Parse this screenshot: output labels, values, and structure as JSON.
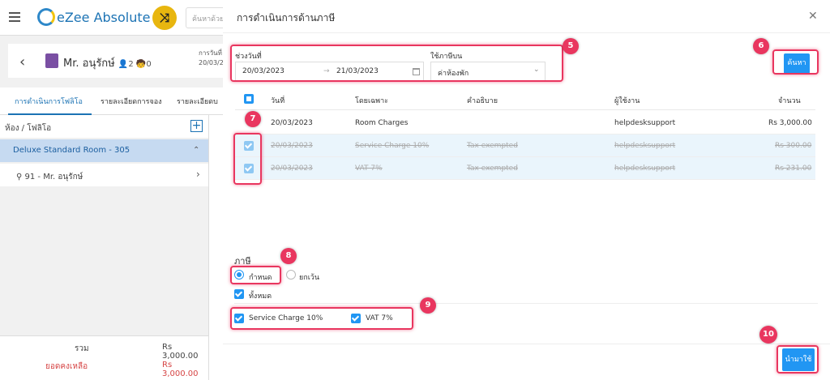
{
  "app": {
    "name": "eZee Absolute",
    "search_placeholder": "ค้นหาด้วย"
  },
  "guest": {
    "name": "Mr. อนุรักษ์",
    "adults": "2",
    "children": "0",
    "date_label": "การวันที่",
    "date_value": "20/03/2"
  },
  "tabs": [
    "การดำเนินการโฟลิโอ",
    "รายละเอียดการจอง",
    "รายละเอียดบ"
  ],
  "sidebar": {
    "header": "ห้อง / โฟลิโอ",
    "room": "Deluxe Standard Room - 305",
    "guest_folio": "91 - Mr. อนุรักษ์",
    "total_label": "รวม",
    "total_value": "Rs 3,000.00",
    "balance_label": "ยอดคงเหลือ",
    "balance_value": "Rs 3,000.00"
  },
  "modal": {
    "title": "การดำเนินการด้านภาษี",
    "date_range_label": "ช่วงวันที่",
    "date_from": "20/03/2023",
    "date_to": "21/03/2023",
    "date_arrow": "→",
    "apply_on_label": "ใช้ภาษีบน",
    "apply_on_value": "ค่าห้องพัก",
    "search_button": "ค้นหา",
    "columns": [
      "วันที่",
      "โดยเฉพาะ",
      "คำอธิบาย",
      "ผู้ใช้งาน",
      "จำนวน"
    ],
    "rows": [
      {
        "date": "20/03/2023",
        "particular": "Room Charges",
        "description": "",
        "user": "helpdesksupport",
        "amount": "Rs 3,000.00"
      },
      {
        "date": "20/03/2023",
        "particular": "Service Charge 10%",
        "description": "Tax exempted",
        "user": "helpdesksupport",
        "amount": "Rs 300.00"
      },
      {
        "date": "20/03/2023",
        "particular": "VAT 7%",
        "description": "Tax exempted",
        "user": "helpdesksupport",
        "amount": "Rs 231.00"
      }
    ],
    "tax_heading": "ภาษี",
    "radio_apply": "กำหนด",
    "radio_exempt": "ยกเว้น",
    "all_label": "ทั้งหมด",
    "tax_options": [
      "Service Charge 10%",
      "VAT 7%"
    ],
    "apply_button": "นำมาใช้"
  },
  "badges": [
    "5",
    "6",
    "7",
    "8",
    "9",
    "10"
  ],
  "colors": {
    "accent": "#2196f3",
    "highlight": "#e9365f",
    "brand": "#1c73b4",
    "selected_row": "#eaf5fc"
  }
}
